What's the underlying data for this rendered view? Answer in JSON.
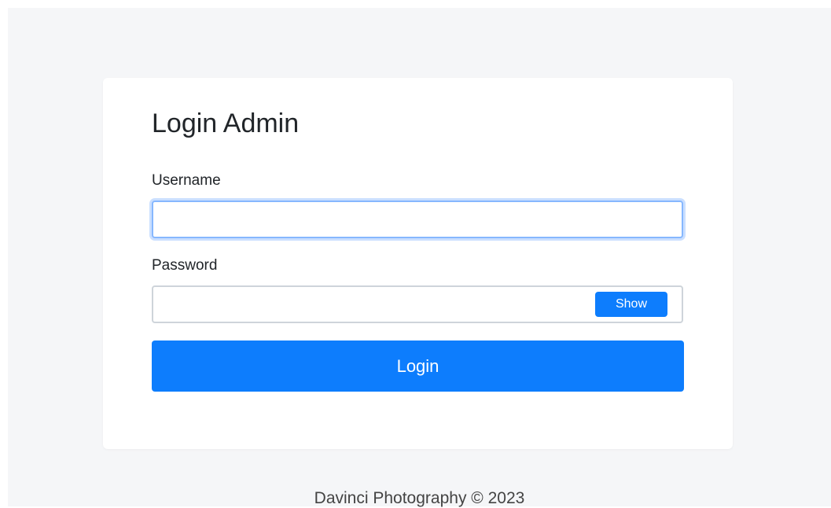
{
  "login_card": {
    "title": "Login Admin",
    "username_label": "Username",
    "username_value": "",
    "password_label": "Password",
    "password_value": "",
    "show_button_label": "Show",
    "login_button_label": "Login"
  },
  "footer": {
    "text": "Davinci Photography © 2023"
  },
  "colors": {
    "background": "#f5f6f8",
    "card": "#ffffff",
    "primary": "#0d7dfd",
    "focus_border": "#86b7fe"
  }
}
